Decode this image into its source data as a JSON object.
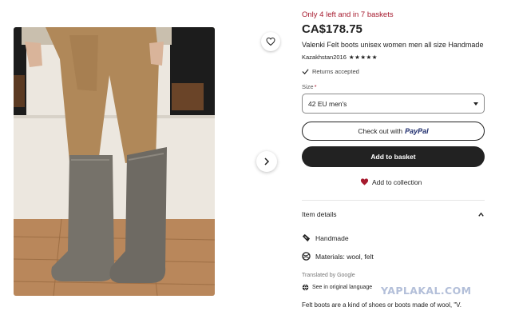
{
  "stock_notice": "Only 4 left and in 7 baskets",
  "price": "CA$178.75",
  "title": "Valenki Felt boots unisex women men all size Handmade",
  "seller": {
    "name": "Kazakhstan2016",
    "stars": "★★★★★",
    "rating": 5
  },
  "returns": "Returns accepted",
  "size": {
    "label": "Size",
    "required_mark": "*",
    "selected": "42 EU men's"
  },
  "buttons": {
    "paypal_prefix": "Check out with",
    "paypal_brand": "PayPal",
    "add_to_basket": "Add to basket",
    "add_to_collection": "Add to collection"
  },
  "item_details": {
    "heading": "Item details",
    "rows": [
      {
        "icon": "handmade-icon",
        "text": "Handmade"
      },
      {
        "icon": "yarn-icon",
        "text": "Materials: wool, felt"
      }
    ]
  },
  "translation": {
    "note": "Translated by Google",
    "link": "See in original language"
  },
  "description": "Felt boots are a kind of shoes or boots made of wool, \"V.",
  "watermark": "YAPLAKAL.COM",
  "colors": {
    "accent": "#a61a2e",
    "button_dark": "#222222",
    "watermark": "#b3bfd9"
  }
}
